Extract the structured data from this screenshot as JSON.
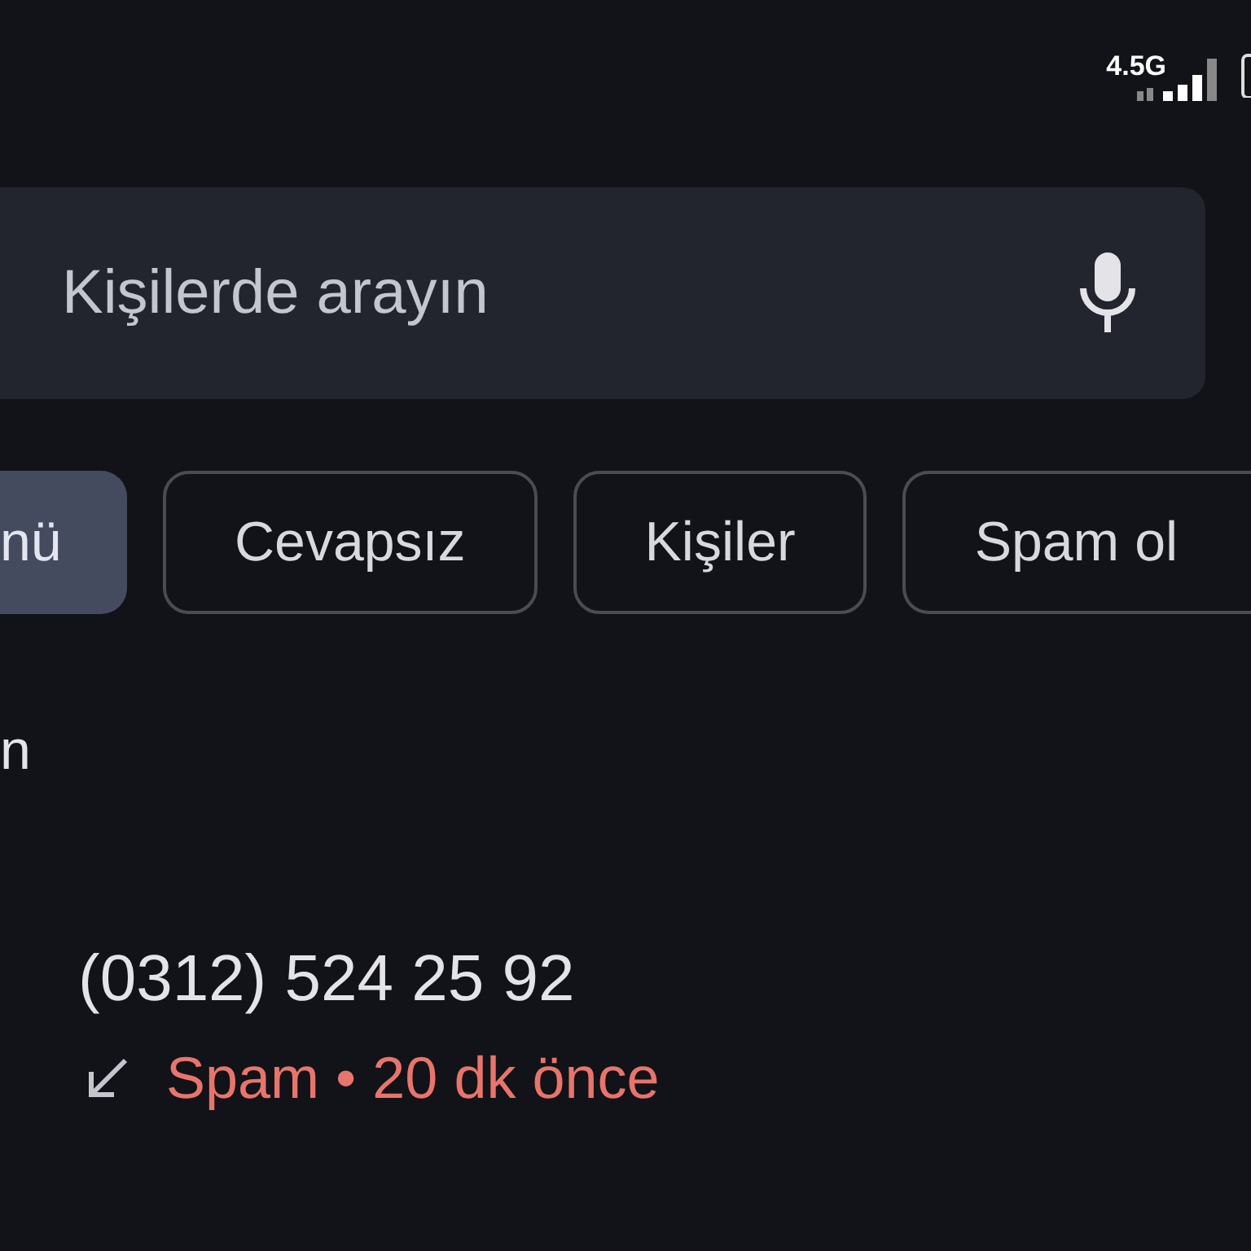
{
  "status_bar": {
    "network": "4.5G"
  },
  "search": {
    "placeholder": "Kişilerde arayın"
  },
  "filters": [
    {
      "label": "nü",
      "selected": true
    },
    {
      "label": "Cevapsız",
      "selected": false
    },
    {
      "label": "Kişiler",
      "selected": false
    },
    {
      "label": "Spam ol",
      "selected": false
    }
  ],
  "section_header": "n",
  "calls": [
    {
      "number": "(0312) 524 25 92",
      "detail": "Spam • 20 dk önce",
      "spam": true
    }
  ]
}
